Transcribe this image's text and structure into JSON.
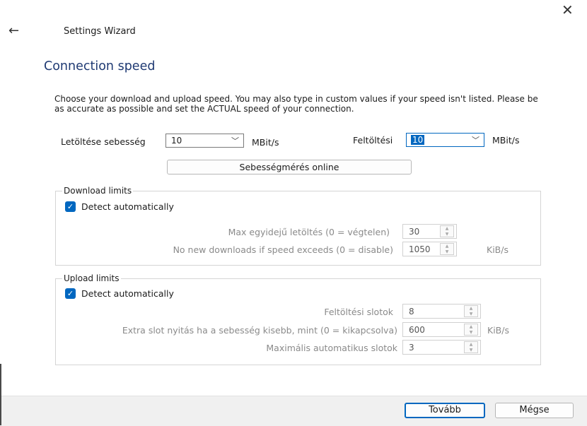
{
  "window": {
    "title": "Settings Wizard",
    "close_glyph": "✕",
    "back_glyph": "←"
  },
  "page": {
    "heading": "Connection speed",
    "description": "Choose your download and upload speed. You may also type in custom values if your speed isn't listed. Please be as accurate as possible and set the ACTUAL speed of your connection."
  },
  "speed": {
    "download_label": "Letöltése sebesség",
    "download_value": "10",
    "download_unit": "MBit/s",
    "upload_label": "Feltöltési",
    "upload_value": "10",
    "upload_unit": "MBit/s",
    "test_button": "Sebességmérés online"
  },
  "download_limits": {
    "title": "Download limits",
    "detect_label": "Detect automatically",
    "detect_checked": true,
    "rows": [
      {
        "label": "Max egyidejű letöltés (0 = végtelen)",
        "value": "30",
        "unit": ""
      },
      {
        "label": "No new downloads if speed exceeds (0 = disable)",
        "value": "1050",
        "unit": "KiB/s"
      }
    ]
  },
  "upload_limits": {
    "title": "Upload limits",
    "detect_label": "Detect automatically",
    "detect_checked": true,
    "rows": [
      {
        "label": "Feltöltési slotok",
        "value": "8",
        "unit": ""
      },
      {
        "label": "Extra slot nyitás ha a sebesség kisebb, mint (0 = kikapcsolva)",
        "value": "600",
        "unit": "KiB/s"
      },
      {
        "label": "Maximális automatikus slotok",
        "value": "3",
        "unit": ""
      }
    ]
  },
  "footer": {
    "next_label": "Tovább",
    "cancel_label": "Mégse"
  },
  "icons": {
    "chevron": "﹀",
    "check": "✓",
    "spin_up": "▲",
    "spin_down": "▼"
  },
  "colors": {
    "accent": "#0067c0",
    "heading": "#1f3a73",
    "disabled_text": "#8a8a8a"
  }
}
